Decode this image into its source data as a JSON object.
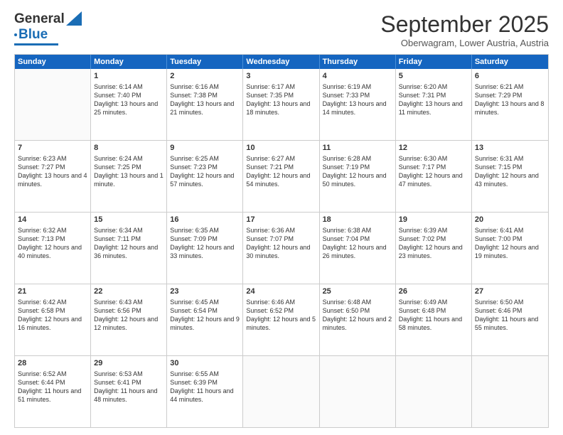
{
  "logo": {
    "line1": "General",
    "line2": "Blue"
  },
  "title": "September 2025",
  "location": "Oberwagram, Lower Austria, Austria",
  "days": [
    "Sunday",
    "Monday",
    "Tuesday",
    "Wednesday",
    "Thursday",
    "Friday",
    "Saturday"
  ],
  "weeks": [
    [
      {
        "day": "",
        "data": ""
      },
      {
        "day": "1",
        "data": "Sunrise: 6:14 AM\nSunset: 7:40 PM\nDaylight: 13 hours and 25 minutes."
      },
      {
        "day": "2",
        "data": "Sunrise: 6:16 AM\nSunset: 7:38 PM\nDaylight: 13 hours and 21 minutes."
      },
      {
        "day": "3",
        "data": "Sunrise: 6:17 AM\nSunset: 7:35 PM\nDaylight: 13 hours and 18 minutes."
      },
      {
        "day": "4",
        "data": "Sunrise: 6:19 AM\nSunset: 7:33 PM\nDaylight: 13 hours and 14 minutes."
      },
      {
        "day": "5",
        "data": "Sunrise: 6:20 AM\nSunset: 7:31 PM\nDaylight: 13 hours and 11 minutes."
      },
      {
        "day": "6",
        "data": "Sunrise: 6:21 AM\nSunset: 7:29 PM\nDaylight: 13 hours and 8 minutes."
      }
    ],
    [
      {
        "day": "7",
        "data": "Sunrise: 6:23 AM\nSunset: 7:27 PM\nDaylight: 13 hours and 4 minutes."
      },
      {
        "day": "8",
        "data": "Sunrise: 6:24 AM\nSunset: 7:25 PM\nDaylight: 13 hours and 1 minute."
      },
      {
        "day": "9",
        "data": "Sunrise: 6:25 AM\nSunset: 7:23 PM\nDaylight: 12 hours and 57 minutes."
      },
      {
        "day": "10",
        "data": "Sunrise: 6:27 AM\nSunset: 7:21 PM\nDaylight: 12 hours and 54 minutes."
      },
      {
        "day": "11",
        "data": "Sunrise: 6:28 AM\nSunset: 7:19 PM\nDaylight: 12 hours and 50 minutes."
      },
      {
        "day": "12",
        "data": "Sunrise: 6:30 AM\nSunset: 7:17 PM\nDaylight: 12 hours and 47 minutes."
      },
      {
        "day": "13",
        "data": "Sunrise: 6:31 AM\nSunset: 7:15 PM\nDaylight: 12 hours and 43 minutes."
      }
    ],
    [
      {
        "day": "14",
        "data": "Sunrise: 6:32 AM\nSunset: 7:13 PM\nDaylight: 12 hours and 40 minutes."
      },
      {
        "day": "15",
        "data": "Sunrise: 6:34 AM\nSunset: 7:11 PM\nDaylight: 12 hours and 36 minutes."
      },
      {
        "day": "16",
        "data": "Sunrise: 6:35 AM\nSunset: 7:09 PM\nDaylight: 12 hours and 33 minutes."
      },
      {
        "day": "17",
        "data": "Sunrise: 6:36 AM\nSunset: 7:07 PM\nDaylight: 12 hours and 30 minutes."
      },
      {
        "day": "18",
        "data": "Sunrise: 6:38 AM\nSunset: 7:04 PM\nDaylight: 12 hours and 26 minutes."
      },
      {
        "day": "19",
        "data": "Sunrise: 6:39 AM\nSunset: 7:02 PM\nDaylight: 12 hours and 23 minutes."
      },
      {
        "day": "20",
        "data": "Sunrise: 6:41 AM\nSunset: 7:00 PM\nDaylight: 12 hours and 19 minutes."
      }
    ],
    [
      {
        "day": "21",
        "data": "Sunrise: 6:42 AM\nSunset: 6:58 PM\nDaylight: 12 hours and 16 minutes."
      },
      {
        "day": "22",
        "data": "Sunrise: 6:43 AM\nSunset: 6:56 PM\nDaylight: 12 hours and 12 minutes."
      },
      {
        "day": "23",
        "data": "Sunrise: 6:45 AM\nSunset: 6:54 PM\nDaylight: 12 hours and 9 minutes."
      },
      {
        "day": "24",
        "data": "Sunrise: 6:46 AM\nSunset: 6:52 PM\nDaylight: 12 hours and 5 minutes."
      },
      {
        "day": "25",
        "data": "Sunrise: 6:48 AM\nSunset: 6:50 PM\nDaylight: 12 hours and 2 minutes."
      },
      {
        "day": "26",
        "data": "Sunrise: 6:49 AM\nSunset: 6:48 PM\nDaylight: 11 hours and 58 minutes."
      },
      {
        "day": "27",
        "data": "Sunrise: 6:50 AM\nSunset: 6:46 PM\nDaylight: 11 hours and 55 minutes."
      }
    ],
    [
      {
        "day": "28",
        "data": "Sunrise: 6:52 AM\nSunset: 6:44 PM\nDaylight: 11 hours and 51 minutes."
      },
      {
        "day": "29",
        "data": "Sunrise: 6:53 AM\nSunset: 6:41 PM\nDaylight: 11 hours and 48 minutes."
      },
      {
        "day": "30",
        "data": "Sunrise: 6:55 AM\nSunset: 6:39 PM\nDaylight: 11 hours and 44 minutes."
      },
      {
        "day": "",
        "data": ""
      },
      {
        "day": "",
        "data": ""
      },
      {
        "day": "",
        "data": ""
      },
      {
        "day": "",
        "data": ""
      }
    ]
  ]
}
